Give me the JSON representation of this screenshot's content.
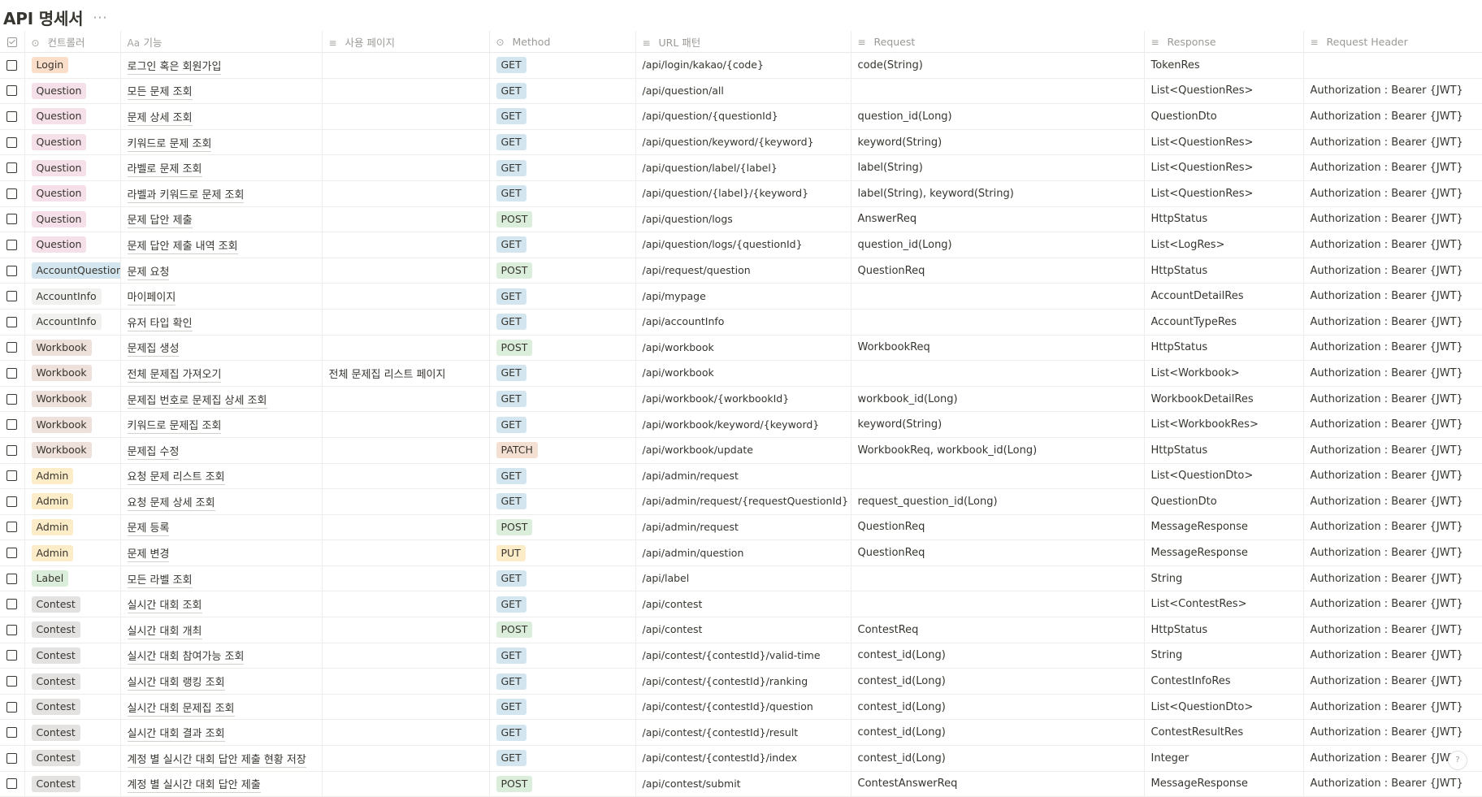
{
  "title": "API 명세서",
  "title_more": "···",
  "header": {
    "controller": "컨트롤러",
    "function": "기능",
    "function_icon": "Aa",
    "page": "사용 페이지",
    "method": "Method",
    "url": "URL 패턴",
    "request": "Request",
    "response": "Response",
    "request_header": "Request Header"
  },
  "colors": {
    "Login": "#fadec9",
    "Question": "#f5e0e9",
    "AccountQuestion": "#d3e5ef",
    "AccountInfo": "#f1f1ef",
    "Workbook": "#eee0da",
    "Admin": "#fdecc8",
    "Label": "#dbeddb",
    "Contest": "#e3e2e0",
    "GET": "#d3e5ef",
    "POST": "#dbeddb",
    "PATCH": "#f4dfd3",
    "PUT": "#fdecc8"
  },
  "rows": [
    {
      "controller": "Login",
      "function": "로그인 혹은 회원가입",
      "page": "",
      "method": "GET",
      "url": "/api/login/kakao/{code}",
      "request": "code(String)",
      "response": "TokenRes",
      "header": ""
    },
    {
      "controller": "Question",
      "function": "모든 문제 조회",
      "page": "",
      "method": "GET",
      "url": "/api/question/all",
      "request": "",
      "response": "List<QuestionRes>",
      "header": "Authorization : Bearer {JWT}"
    },
    {
      "controller": "Question",
      "function": "문제 상세 조회",
      "page": "",
      "method": "GET",
      "url": "/api/question/{questionId}",
      "request": "question_id(Long)",
      "response": "QuestionDto",
      "header": "Authorization : Bearer {JWT}"
    },
    {
      "controller": "Question",
      "function": "키워드로 문제 조회",
      "page": "",
      "method": "GET",
      "url": "/api/question/keyword/{keyword}",
      "request": "keyword(String)",
      "response": "List<QuestionRes>",
      "header": "Authorization : Bearer {JWT}"
    },
    {
      "controller": "Question",
      "function": "라벨로 문제 조회",
      "page": "",
      "method": "GET",
      "url": "/api/question/label/{label}",
      "request": "label(String)",
      "response": "List<QuestionRes>",
      "header": "Authorization : Bearer {JWT}"
    },
    {
      "controller": "Question",
      "function": "라벨과 키워드로 문제 조회",
      "page": "",
      "method": "GET",
      "url": "/api/question/{label}/{keyword}",
      "request": "label(String), keyword(String)",
      "response": "List<QuestionRes>",
      "header": "Authorization : Bearer {JWT}"
    },
    {
      "controller": "Question",
      "function": "문제 답안 제출",
      "page": "",
      "method": "POST",
      "url": "/api/question/logs",
      "request": "AnswerReq",
      "response": "HttpStatus",
      "header": "Authorization : Bearer {JWT}"
    },
    {
      "controller": "Question",
      "function": "문제 답안 제출 내역 조회",
      "page": "",
      "method": "GET",
      "url": "/api/question/logs/{questionId}",
      "request": "question_id(Long)",
      "response": "List<LogRes>",
      "header": "Authorization : Bearer {JWT}"
    },
    {
      "controller": "AccountQuestion",
      "function": "문제 요청",
      "page": "",
      "method": "POST",
      "url": "/api/request/question",
      "request": "QuestionReq",
      "response": "HttpStatus",
      "header": "Authorization : Bearer {JWT}"
    },
    {
      "controller": "AccountInfo",
      "function": "마이페이지",
      "page": "",
      "method": "GET",
      "url": "/api/mypage",
      "request": "",
      "response": "AccountDetailRes",
      "header": "Authorization : Bearer {JWT}"
    },
    {
      "controller": "AccountInfo",
      "function": "유저 타입 확인",
      "page": "",
      "method": "GET",
      "url": "/api/accountInfo",
      "request": "",
      "response": "AccountTypeRes",
      "header": "Authorization : Bearer {JWT}"
    },
    {
      "controller": "Workbook",
      "function": "문제집 생성",
      "page": "",
      "method": "POST",
      "url": "/api/workbook",
      "request": "WorkbookReq",
      "response": "HttpStatus",
      "header": "Authorization : Bearer {JWT}"
    },
    {
      "controller": "Workbook",
      "function": "전체 문제집 가져오기",
      "page": "전체 문제집 리스트 페이지",
      "method": "GET",
      "url": "/api/workbook",
      "request": "",
      "response": "List<Workbook>",
      "header": "Authorization : Bearer {JWT}"
    },
    {
      "controller": "Workbook",
      "function": "문제집 번호로 문제집 상세 조회",
      "page": "",
      "method": "GET",
      "url": "/api/workbook/{workbookId}",
      "request": "workbook_id(Long)",
      "response": "WorkbookDetailRes",
      "header": "Authorization : Bearer {JWT}"
    },
    {
      "controller": "Workbook",
      "function": "키워드로 문제집 조회",
      "page": "",
      "method": "GET",
      "url": "/api/workbook/keyword/{keyword}",
      "request": "keyword(String)",
      "response": "List<WorkbookRes>",
      "header": "Authorization : Bearer {JWT}"
    },
    {
      "controller": "Workbook",
      "function": "문제집 수정",
      "page": "",
      "method": "PATCH",
      "url": "/api/workbook/update",
      "request": "WorkbookReq, workbook_id(Long)",
      "response": "HttpStatus",
      "header": "Authorization : Bearer {JWT}"
    },
    {
      "controller": "Admin",
      "function": "요청 문제 리스트 조회",
      "page": "",
      "method": "GET",
      "url": "/api/admin/request",
      "request": "",
      "response": "List<QuestionDto>",
      "header": "Authorization : Bearer {JWT}"
    },
    {
      "controller": "Admin",
      "function": "요청 문제 상세 조회",
      "page": "",
      "method": "GET",
      "url": "/api/admin/request/{requestQuestionId}",
      "request": "request_question_id(Long)",
      "response": "QuestionDto",
      "header": "Authorization : Bearer {JWT}"
    },
    {
      "controller": "Admin",
      "function": "문제 등록",
      "page": "",
      "method": "POST",
      "url": "/api/admin/request",
      "request": "QuestionReq",
      "response": "MessageResponse",
      "header": "Authorization : Bearer {JWT}"
    },
    {
      "controller": "Admin",
      "function": "문제 변경",
      "page": "",
      "method": "PUT",
      "url": "/api/admin/question",
      "request": "QuestionReq",
      "response": "MessageResponse",
      "header": "Authorization : Bearer {JWT}"
    },
    {
      "controller": "Label",
      "function": "모든 라벨 조회",
      "page": "",
      "method": "GET",
      "url": "/api/label",
      "request": "",
      "response": "String",
      "header": "Authorization : Bearer {JWT}"
    },
    {
      "controller": "Contest",
      "function": "실시간 대회 조회",
      "page": "",
      "method": "GET",
      "url": "/api/contest",
      "request": "",
      "response": "List<ContestRes>",
      "header": "Authorization : Bearer {JWT}"
    },
    {
      "controller": "Contest",
      "function": "실시간 대회 개최",
      "page": "",
      "method": "POST",
      "url": "/api/contest",
      "request": "ContestReq",
      "response": "HttpStatus",
      "header": "Authorization : Bearer {JWT}"
    },
    {
      "controller": "Contest",
      "function": "실시간 대회 참여가능 조회",
      "page": "",
      "method": "GET",
      "url": "/api/contest/{contestId}/valid-time",
      "request": "contest_id(Long)",
      "response": "String",
      "header": "Authorization : Bearer {JWT}"
    },
    {
      "controller": "Contest",
      "function": "실시간 대회 랭킹 조회",
      "page": "",
      "method": "GET",
      "url": "/api/contest/{contestId}/ranking",
      "request": "contest_id(Long)",
      "response": "ContestInfoRes",
      "header": "Authorization : Bearer {JWT}"
    },
    {
      "controller": "Contest",
      "function": "실시간 대회 문제집 조회",
      "page": "",
      "method": "GET",
      "url": "/api/contest/{contestId}/question",
      "request": "contest_id(Long)",
      "response": "List<QuestionDto>",
      "header": "Authorization : Bearer {JWT}"
    },
    {
      "controller": "Contest",
      "function": "실시간 대회 결과 조회",
      "page": "",
      "method": "GET",
      "url": "/api/contest/{contestId}/result",
      "request": "contest_id(Long)",
      "response": "ContestResultRes",
      "header": "Authorization : Bearer {JWT}"
    },
    {
      "controller": "Contest",
      "function": "계정 별 실시간 대회 답안 제출 현황 저장",
      "page": "",
      "method": "GET",
      "url": "/api/contest/{contestId}/index",
      "request": "contest_id(Long)",
      "response": "Integer",
      "header": "Authorization : Bearer {JWT}"
    },
    {
      "controller": "Contest",
      "function": "계정 별 실시간 대회 답안 제출",
      "page": "",
      "method": "POST",
      "url": "/api/contest/submit",
      "request": "ContestAnswerReq",
      "response": "MessageResponse",
      "header": "Authorization : Bearer {JWT}"
    }
  ]
}
